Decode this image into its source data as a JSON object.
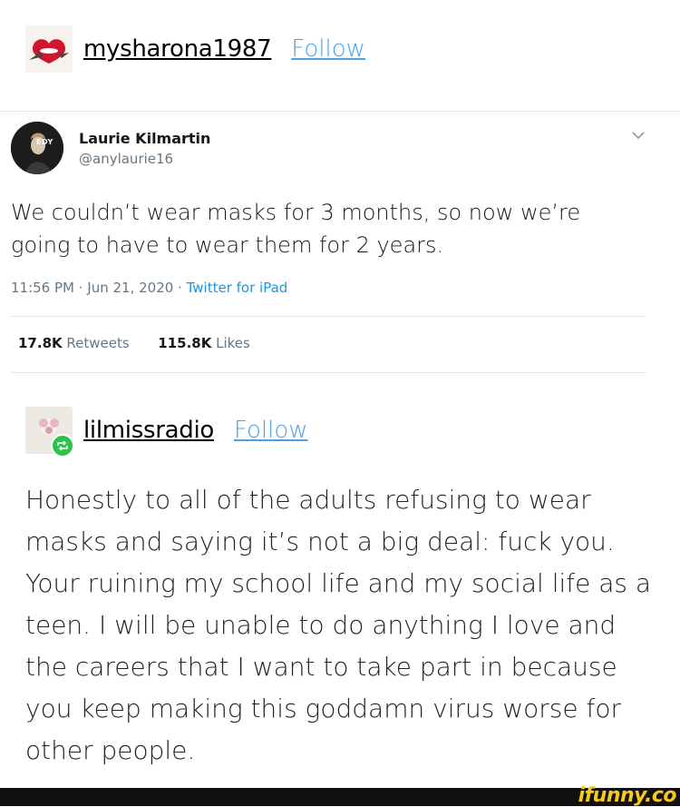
{
  "post1": {
    "username": "mysharona1987",
    "follow_label": "Follow"
  },
  "tweet": {
    "name": "Laurie Kilmartin",
    "handle": "@anylaurie16",
    "avatar_text": "EDY",
    "text": "We couldn’t wear masks for 3 months, so now we’re going to have to wear them for 2 years.",
    "time": "11:56 PM · Jun 21, 2020 · ",
    "source": "Twitter for iPad",
    "retweets_count": "17.8K",
    "retweets_label": "Retweets",
    "likes_count": "115.8K",
    "likes_label": "Likes"
  },
  "post2": {
    "username": "lilmissradio",
    "follow_label": "Follow",
    "body": "Honestly to all of the adults refusing to wear masks and saying it’s not a big deal: fuck you. Your ruining my school life and my social life as a teen. I will be unable to do anything I love and the careers that I want to take part in because you keep making this goddamn virus worse for other people."
  },
  "watermark": "ifunny.co",
  "colors": {
    "follow": "#4da0e3",
    "twitter_link": "#1b95e0",
    "reblog_badge": "#2ec24a",
    "watermark": "#f6c91c"
  }
}
